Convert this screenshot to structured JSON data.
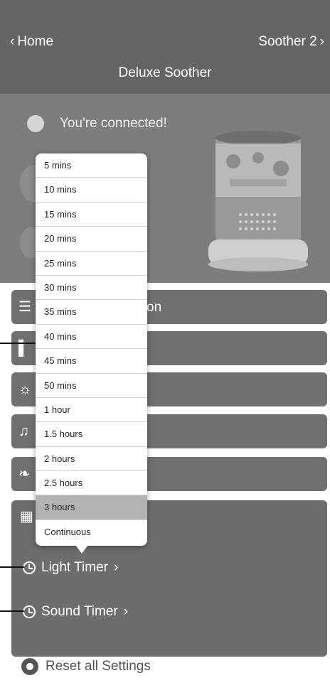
{
  "nav": {
    "back_label": "Home",
    "right_label": "Soother 2",
    "title": "Deluxe Soother"
  },
  "hero": {
    "status_text": "You're connected!"
  },
  "rows": [
    {
      "icon": "night-light-icon",
      "label": "on"
    },
    {
      "icon": "lamp-icon",
      "label": ""
    },
    {
      "icon": "brightness-icon",
      "label": ""
    },
    {
      "icon": "music-note-icon",
      "label": ""
    },
    {
      "icon": "leaf-icon",
      "label": ""
    },
    {
      "icon": "calendar-icon",
      "label": ""
    }
  ],
  "timers": {
    "light_timer_label": "Light Timer",
    "sound_timer_label": "Sound Timer"
  },
  "reset": {
    "label": "Reset all Settings"
  },
  "dropdown": {
    "selected": "3 hours",
    "options": [
      "5 mins",
      "10 mins",
      "15 mins",
      "20 mins",
      "25 mins",
      "30 mins",
      "35 mins",
      "40 mins",
      "45 mins",
      "50 mins",
      "1 hour",
      "1.5 hours",
      "2 hours",
      "2.5 hours",
      "3 hours",
      "Continuous"
    ]
  },
  "colors": {
    "nav_bg": "#656565",
    "hero_bg": "#7d7d7d",
    "row_bg": "#707070",
    "selected_bg": "#b3b3b3"
  }
}
